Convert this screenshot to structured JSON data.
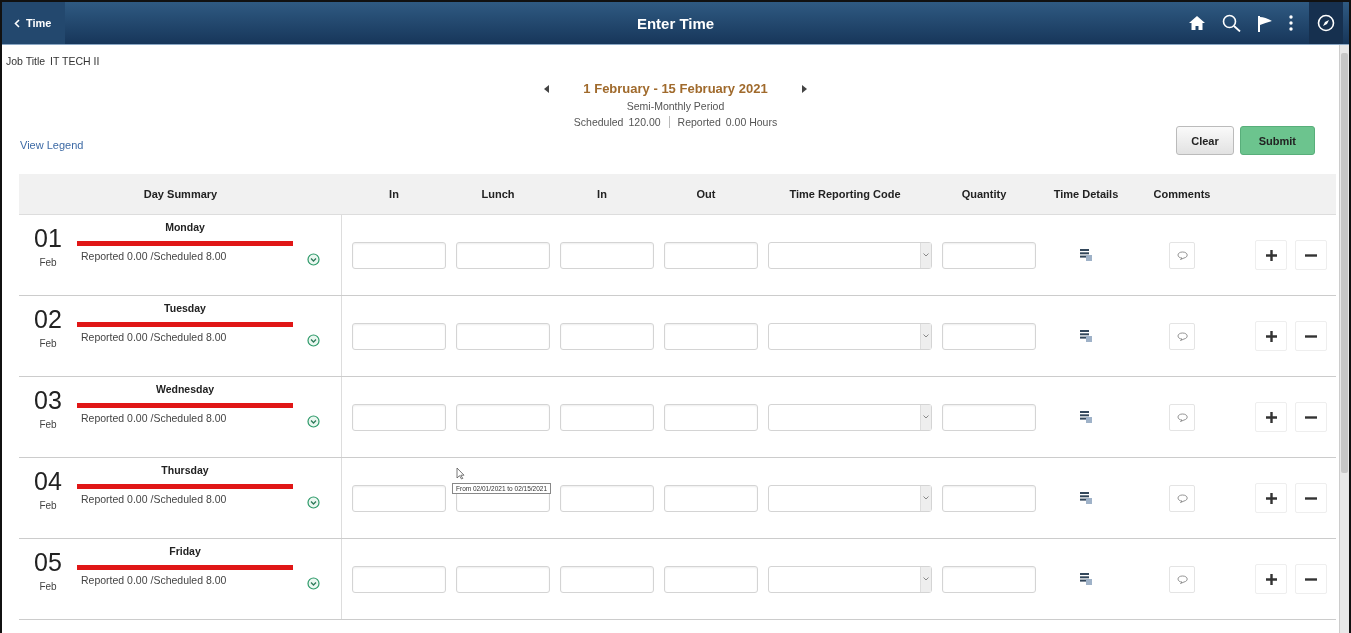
{
  "header": {
    "back_label": "Time",
    "title": "Enter Time"
  },
  "job_title": {
    "label": "Job Title",
    "value": "IT TECH II"
  },
  "period": {
    "range": "1 February - 15 February 2021",
    "type": "Semi-Monthly Period",
    "scheduled_label": "Scheduled",
    "scheduled": "120.00",
    "reported_label": "Reported",
    "reported": "0.00 Hours"
  },
  "legend_link": "View Legend",
  "buttons": [
    {
      "label": "Clear",
      "kind": "secondary"
    },
    {
      "label": "Submit",
      "kind": "primary"
    }
  ],
  "table": {
    "columns": [
      "Day Summary",
      "In",
      "Lunch",
      "In",
      "Out",
      "Time Reporting Code",
      "Quantity",
      "Time Details",
      "Comments"
    ],
    "rows": [
      {
        "day": "01",
        "month": "Feb",
        "weekday": "Monday",
        "summary": "Reported 0.00 /Scheduled 8.00"
      },
      {
        "day": "02",
        "month": "Feb",
        "weekday": "Tuesday",
        "summary": "Reported 0.00 /Scheduled 8.00"
      },
      {
        "day": "03",
        "month": "Feb",
        "weekday": "Wednesday",
        "summary": "Reported 0.00 /Scheduled 8.00"
      },
      {
        "day": "04",
        "month": "Feb",
        "weekday": "Thursday",
        "summary": "Reported 0.00 /Scheduled 8.00"
      },
      {
        "day": "05",
        "month": "Feb",
        "weekday": "Friday",
        "summary": "Reported 0.00 /Scheduled 8.00"
      }
    ]
  },
  "tooltip": "From 02/01/2021 to 02/15/2021"
}
